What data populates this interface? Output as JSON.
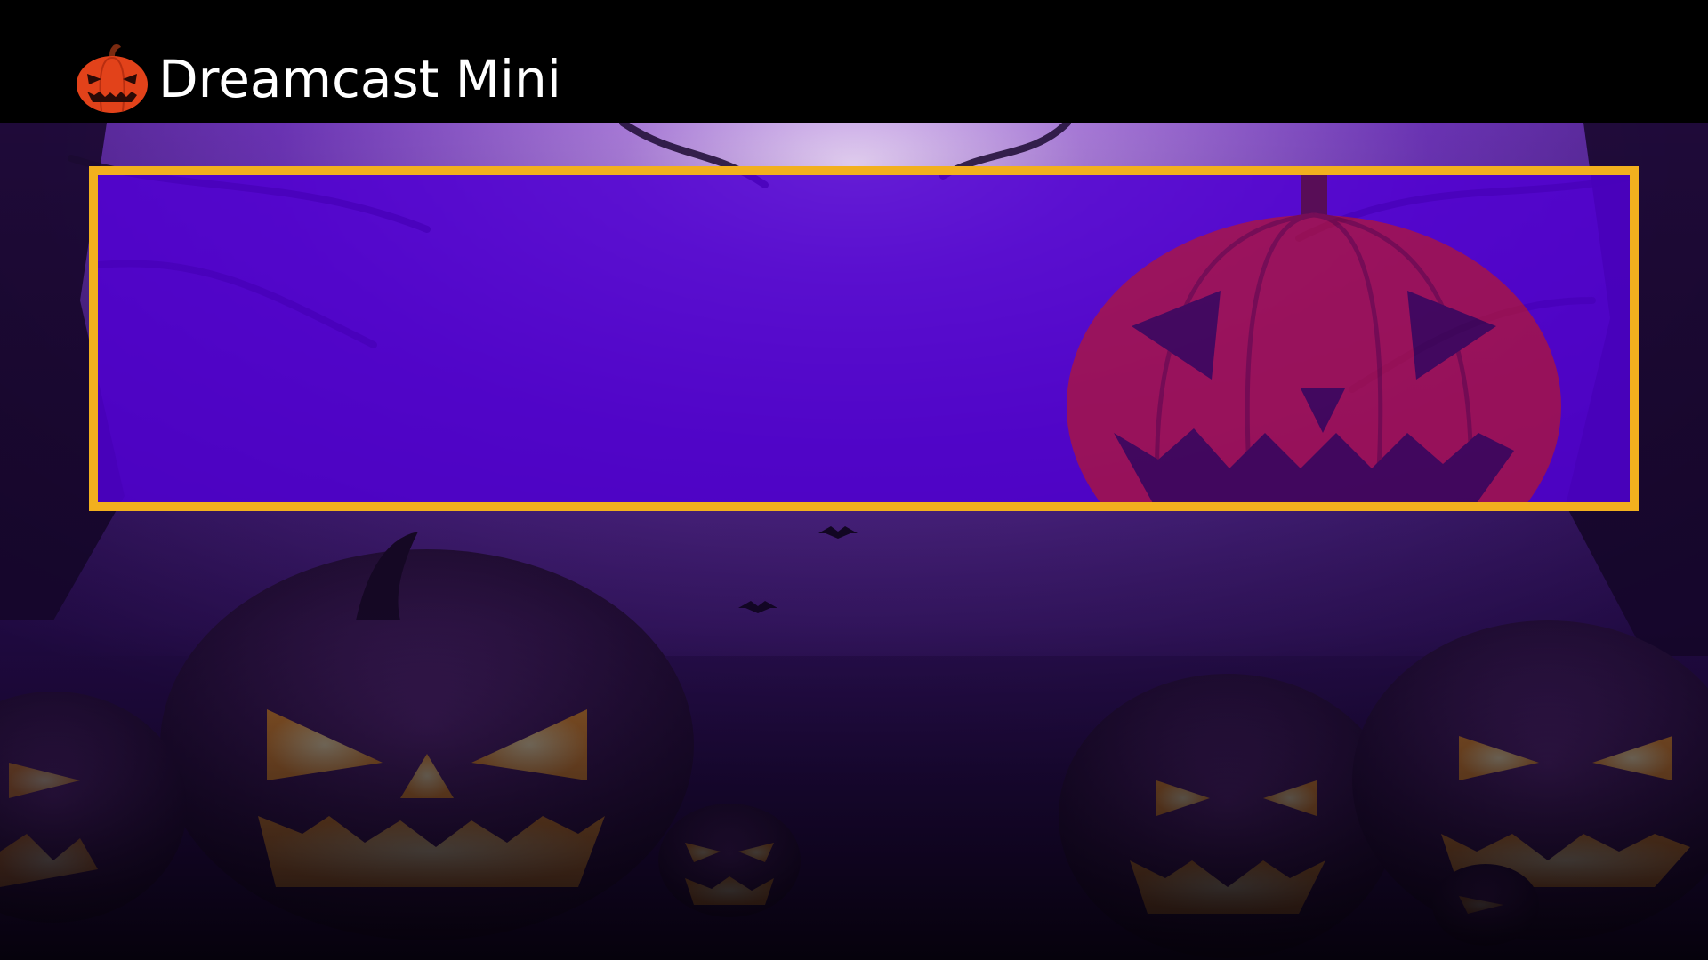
{
  "header": {
    "logo_icon": "jack-o-lantern-icon",
    "title": "Dreamcast Mini"
  },
  "panel": {
    "highlight_color": "#f2b01e",
    "fill_color": "#5000d2",
    "art_icon": "jack-o-lantern-icon"
  },
  "theme": {
    "background_color": "#3b1670",
    "accent_color": "#ff9a2a"
  }
}
